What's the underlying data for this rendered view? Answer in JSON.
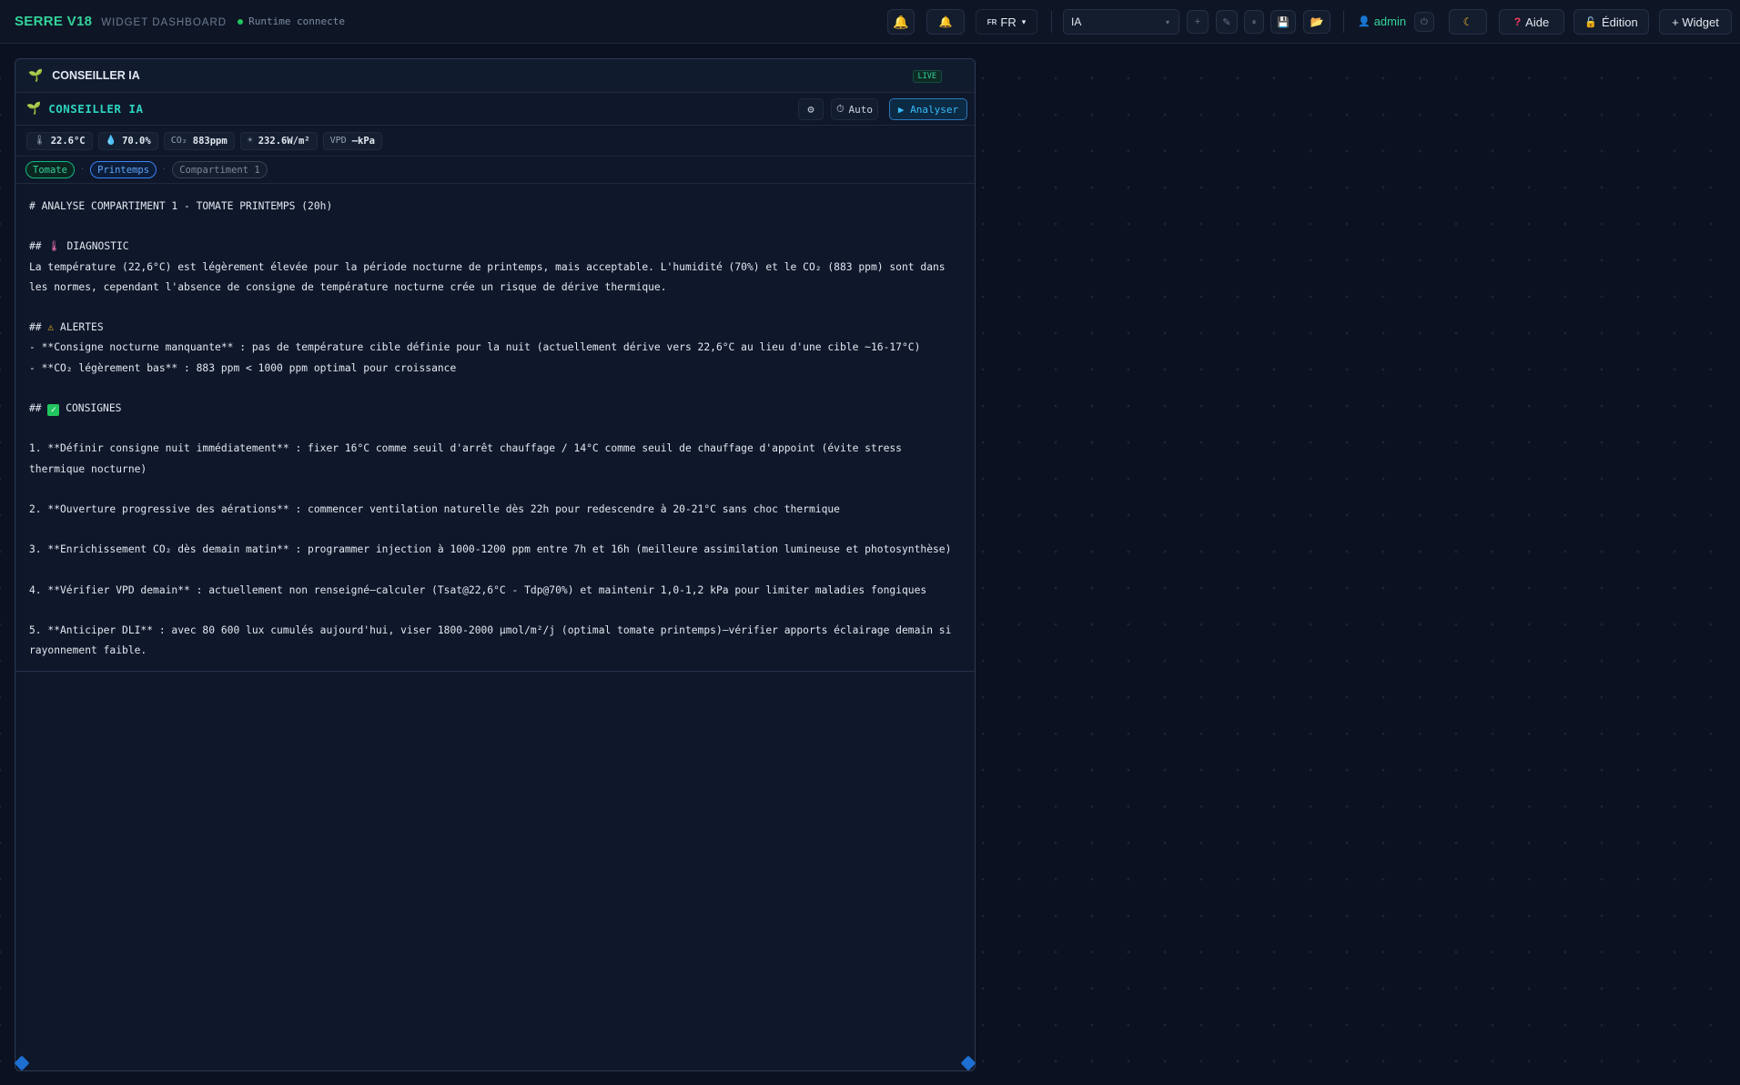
{
  "topbar": {
    "brand": "SERRE V18",
    "subtitle": "WIDGET DASHBOARD",
    "runtime_status": "Runtime connecte",
    "lang_flag": "FR",
    "lang_value": "FR",
    "layout_select": "IA",
    "add_label": "+",
    "edit_icon": "✎",
    "pause_icon": "⏸",
    "user_name": "admin",
    "help_label": "Aide",
    "edit_mode_label": "Édition",
    "add_widget_label": "+ Widget",
    "icons": {
      "bell": "bell-icon",
      "bell_alert": "bell-alert-icon",
      "save": "save-icon",
      "folder": "folder-icon",
      "power": "power-icon",
      "moon": "moon-icon",
      "help": "question-icon",
      "lock": "unlock-icon"
    }
  },
  "widget": {
    "title": "CONSEILLER IA",
    "live_badge": "LIVE",
    "panel_title": "CONSEILLER IA",
    "auto_label": "Auto",
    "analyze_label": "▶ Analyser",
    "metrics": {
      "temp": "22.6°C",
      "humidity": "70.0%",
      "co2_label": "CO₂",
      "co2": "883ppm",
      "radiation": "232.6W/m²",
      "vpd_label": "VPD",
      "vpd": "—kPa"
    },
    "tags": {
      "crop": "Tomate",
      "season": "Printemps",
      "compartment": "Compartiment 1"
    },
    "analysis": {
      "heading": "# ANALYSE COMPARTIMENT 1 - TOMATE PRINTEMPS (20h)",
      "diag_prefix": "## ",
      "diag_title": " DIAGNOSTIC",
      "diag_text": "La température (22,6°C) est légèrement élevée pour la période nocturne de printemps, mais acceptable. L'humidité (70%) et le CO₂ (883 ppm) sont dans les normes, cependant l'absence de consigne de température nocturne crée un risque de dérive thermique.",
      "alerts_prefix": "## ",
      "alerts_title": " ALERTES",
      "alert_1": "- **Consigne nocturne manquante** : pas de température cible définie pour la nuit (actuellement dérive vers 22,6°C au lieu d'une cible ~16-17°C)",
      "alert_2": "- **CO₂ légèrement bas** : 883 ppm < 1000 ppm optimal pour croissance",
      "consignes_prefix": "## ",
      "consignes_title": " CONSIGNES",
      "item_1": "1. **Définir consigne nuit immédiatement** : fixer 16°C comme seuil d'arrêt chauffage / 14°C comme seuil de chauffage d'appoint (évite stress thermique nocturne)",
      "item_2": "2. **Ouverture progressive des aérations** : commencer ventilation naturelle dès 22h pour redescendre à 20-21°C sans choc thermique",
      "item_3": "3. **Enrichissement CO₂ dès demain matin** : programmer injection à 1000-1200 ppm entre 7h et 16h (meilleure assimilation lumineuse et photosynthèse)",
      "item_4": "4. **Vérifier VPD demain** : actuellement non renseigné—calculer (Tsat@22,6°C - Tdp@70%) et maintenir 1,0-1,2 kPa pour limiter maladies fongiques",
      "item_5": "5. **Anticiper DLI** : avec 80 600 lux cumulés aujourd'hui, viser 1800-2000 µmol/m²/j (optimal tomate printemps)—vérifier apports éclairage demain si rayonnement faible."
    }
  },
  "colors": {
    "background": "#0b1120",
    "brand": "#34d399",
    "accent_blue": "#38bdf8",
    "panel": "#0f172a"
  }
}
